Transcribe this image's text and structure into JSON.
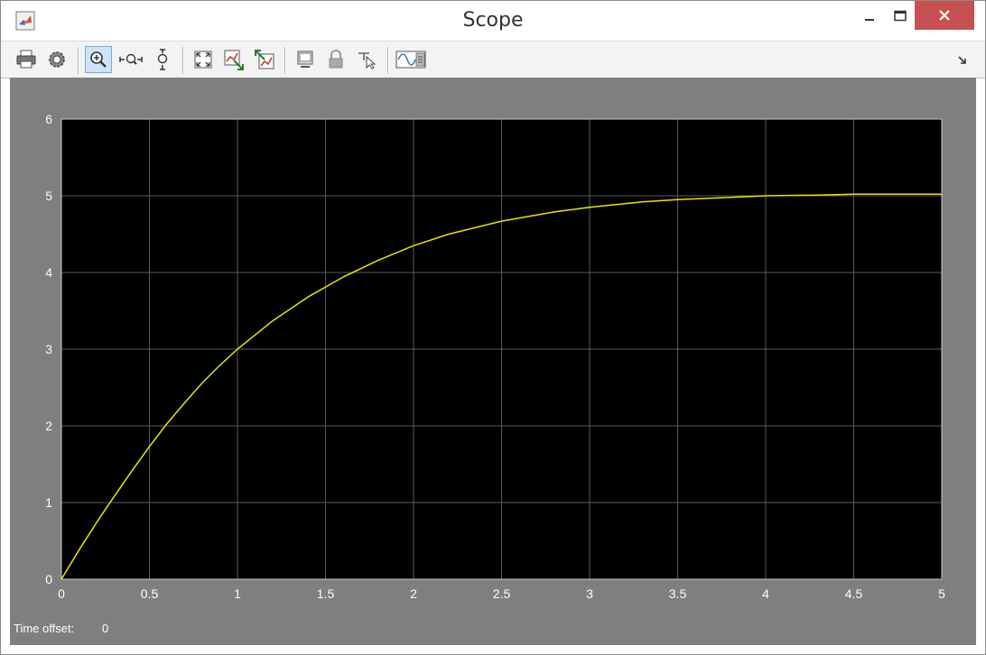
{
  "window": {
    "title": "Scope",
    "controls": {
      "minimize": "–",
      "maximize": "□",
      "close": "✕"
    }
  },
  "toolbar": {
    "items": [
      {
        "name": "print-icon"
      },
      {
        "name": "parameters-gear-icon"
      },
      {
        "name": "zoom-in-icon",
        "active": true
      },
      {
        "name": "zoom-x-icon"
      },
      {
        "name": "zoom-y-icon"
      },
      {
        "name": "autoscale-icon"
      },
      {
        "name": "save-axes-settings-icon"
      },
      {
        "name": "restore-axes-settings-icon"
      },
      {
        "name": "floating-scope-icon"
      },
      {
        "name": "lock-axes-icon"
      },
      {
        "name": "signal-selection-icon"
      },
      {
        "name": "legend-icon"
      }
    ],
    "overflow": "dock-arrow-icon"
  },
  "status": {
    "time_offset_label": "Time offset:",
    "time_offset_value": "0"
  },
  "colors": {
    "plot_background": "#000000",
    "figure_background": "#7f7f7f",
    "grid": "#5a5a5a",
    "trace": "#e6e600",
    "tick_text": "#ffffff"
  },
  "chart_data": {
    "type": "line",
    "title": "",
    "xlabel": "",
    "ylabel": "",
    "xlim": [
      0,
      5
    ],
    "ylim": [
      0,
      6
    ],
    "xticks": [
      "0",
      "0.5",
      "1",
      "1.5",
      "2",
      "2.5",
      "3",
      "3.5",
      "4",
      "4.5",
      "5"
    ],
    "yticks": [
      "0",
      "1",
      "2",
      "3",
      "4",
      "5",
      "6"
    ],
    "grid": true,
    "series": [
      {
        "x": [
          0,
          0.1,
          0.2,
          0.3,
          0.4,
          0.5,
          0.6,
          0.7,
          0.8,
          0.9,
          1.0,
          1.2,
          1.4,
          1.6,
          1.8,
          2.0,
          2.2,
          2.5,
          2.8,
          3.0,
          3.3,
          3.5,
          3.8,
          4.0,
          4.3,
          4.5,
          4.8,
          5.0
        ],
        "y": [
          0,
          0.38,
          0.74,
          1.08,
          1.41,
          1.73,
          2.03,
          2.3,
          2.56,
          2.79,
          3.0,
          3.37,
          3.68,
          3.94,
          4.16,
          4.35,
          4.5,
          4.67,
          4.79,
          4.85,
          4.92,
          4.95,
          4.98,
          5.0,
          5.01,
          5.02,
          5.02,
          5.02
        ]
      }
    ]
  }
}
